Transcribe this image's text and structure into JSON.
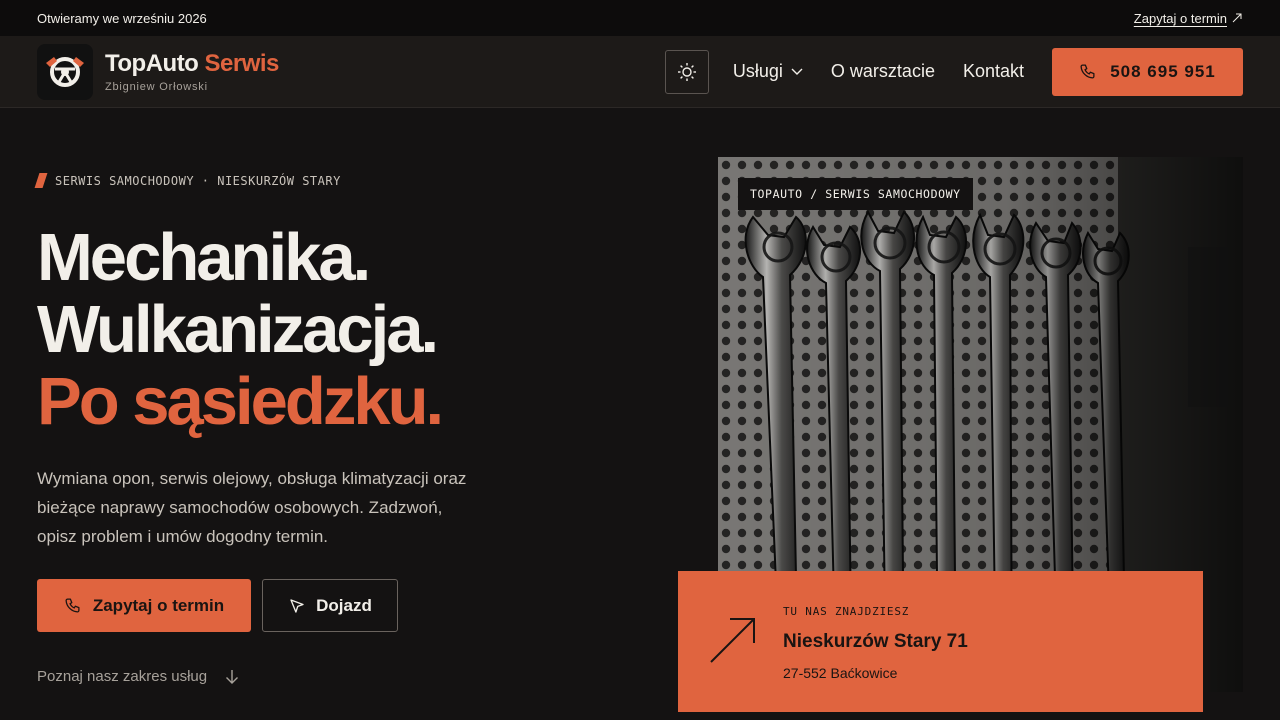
{
  "topbar": {
    "announcement": "Otwieramy we wrześniu 2026",
    "link_label": "Zapytaj o termin"
  },
  "header": {
    "brand_main": "TopAuto",
    "brand_accent": "Serwis",
    "brand_sub": "Zbigniew Orłowski",
    "nav": {
      "services": "Usługi",
      "about": "O warsztacie",
      "contact": "Kontakt"
    },
    "phone": "508 695 951"
  },
  "hero": {
    "eyebrow": "SERWIS SAMOCHODOWY · NIESKURZÓW STARY",
    "headline": [
      "Mechanika.",
      "Wulkanizacja.",
      "Po sąsiedzku."
    ],
    "lead": "Wymiana opon, serwis olejowy, obsługa klimatyzacji oraz bieżące naprawy samochodów osobowych. Zadzwoń, opisz problem i umów dogodny termin.",
    "primary_cta": "Zapytaj o termin",
    "secondary_cta": "Dojazd",
    "more_link": "Poznaj nasz zakres usług"
  },
  "photo": {
    "tag": "TOPAUTO / SERWIS SAMOCHODOWY"
  },
  "location": {
    "label": "TU NAS ZNAJDZIESZ",
    "address": "Nieskurzów Stary 71",
    "city": "27-552 Baćkowice"
  },
  "colors": {
    "accent": "#e0643f",
    "background": "#141212",
    "header": "#1d1a18",
    "topbar": "#0d0c0c",
    "text": "#f2efe9",
    "muted": "#c9c3bb"
  },
  "icons": {
    "logo": "steering-wrench-icon",
    "theme": "sun-icon",
    "phone": "phone-icon",
    "navigate": "cursor-arrow-icon",
    "scroll": "arrow-down-icon",
    "external": "arrow-up-right-icon"
  }
}
